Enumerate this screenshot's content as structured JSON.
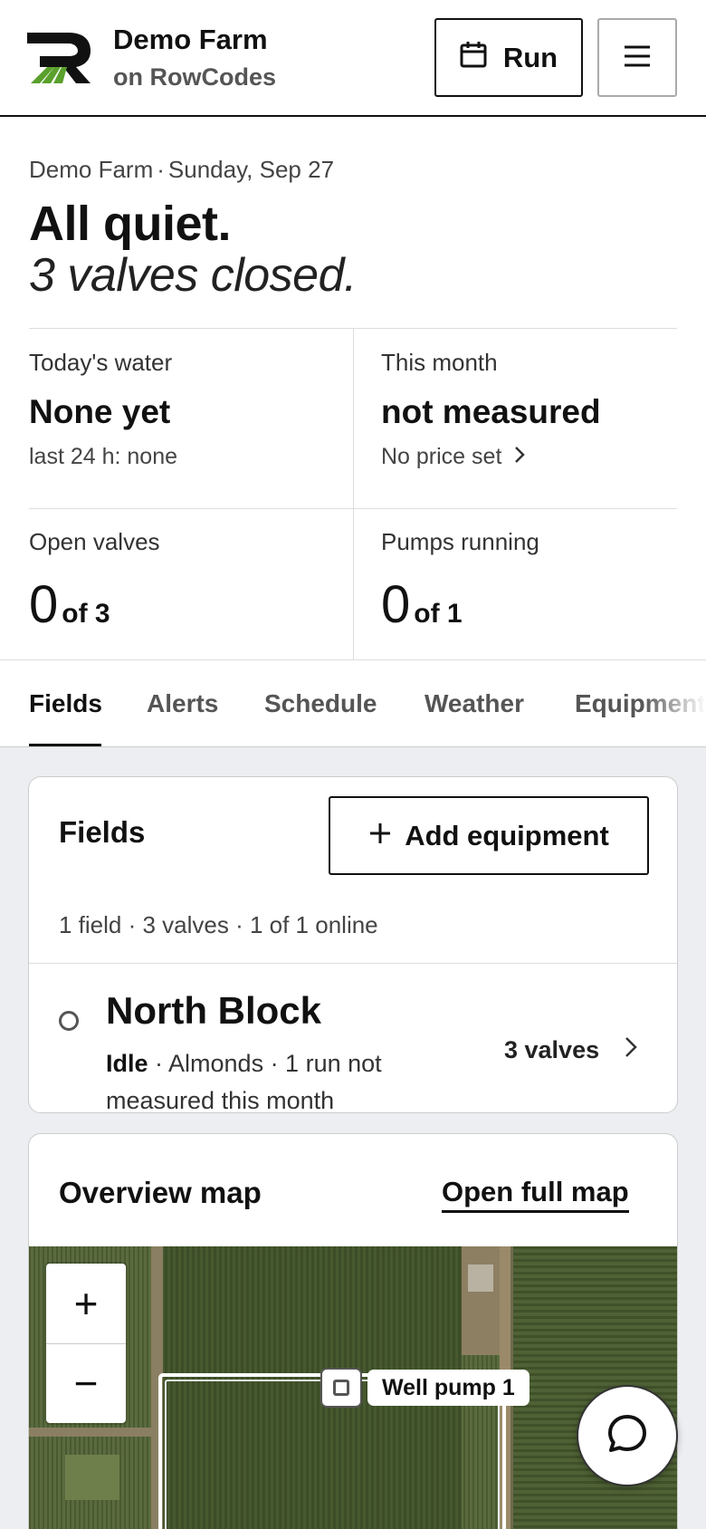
{
  "header": {
    "brand_title": "Demo Farm",
    "brand_subtitle": "on RowCodes",
    "run_label": "Run",
    "icons": {
      "logo": "rowcodes-logo",
      "run": "calendar-icon",
      "menu": "hamburger-menu-icon"
    }
  },
  "summary": {
    "farm": "Demo Farm",
    "separator": "·",
    "date": "Sunday, Sep 27",
    "headline": "All quiet.",
    "subline": "3 valves closed.",
    "stats": {
      "todays_water": {
        "label": "Today's water",
        "value": "None yet",
        "sub": "last 24 h: none"
      },
      "this_month": {
        "label": "This month",
        "value": "not measured",
        "sub": "No price set"
      },
      "open_valves": {
        "label": "Open valves",
        "count": "0",
        "of": "of 3"
      },
      "pumps_running": {
        "label": "Pumps running",
        "count": "0",
        "of": "of 1"
      }
    }
  },
  "tabs": {
    "active": "Fields",
    "items": [
      "Fields",
      "Alerts",
      "Schedule",
      "Weather",
      "Equipment"
    ]
  },
  "fields_card": {
    "title": "Fields",
    "add_label": "Add equipment",
    "meta": "1 field · 3 valves · 1 of 1 online",
    "field": {
      "name": "North Block",
      "status": "Idle",
      "desc": " · Almonds · 1 run not measured this month",
      "count": "3 valves"
    }
  },
  "map_card": {
    "title": "Overview map",
    "link": "Open full map",
    "zoom_in": "+",
    "zoom_out": "−",
    "pump_label": "Well pump 1"
  },
  "colors": {
    "text": "#111111",
    "muted": "#555555",
    "page_bg": "#eceef2",
    "logo_green": "#5aa02c",
    "field_outline": "#ffffff"
  }
}
